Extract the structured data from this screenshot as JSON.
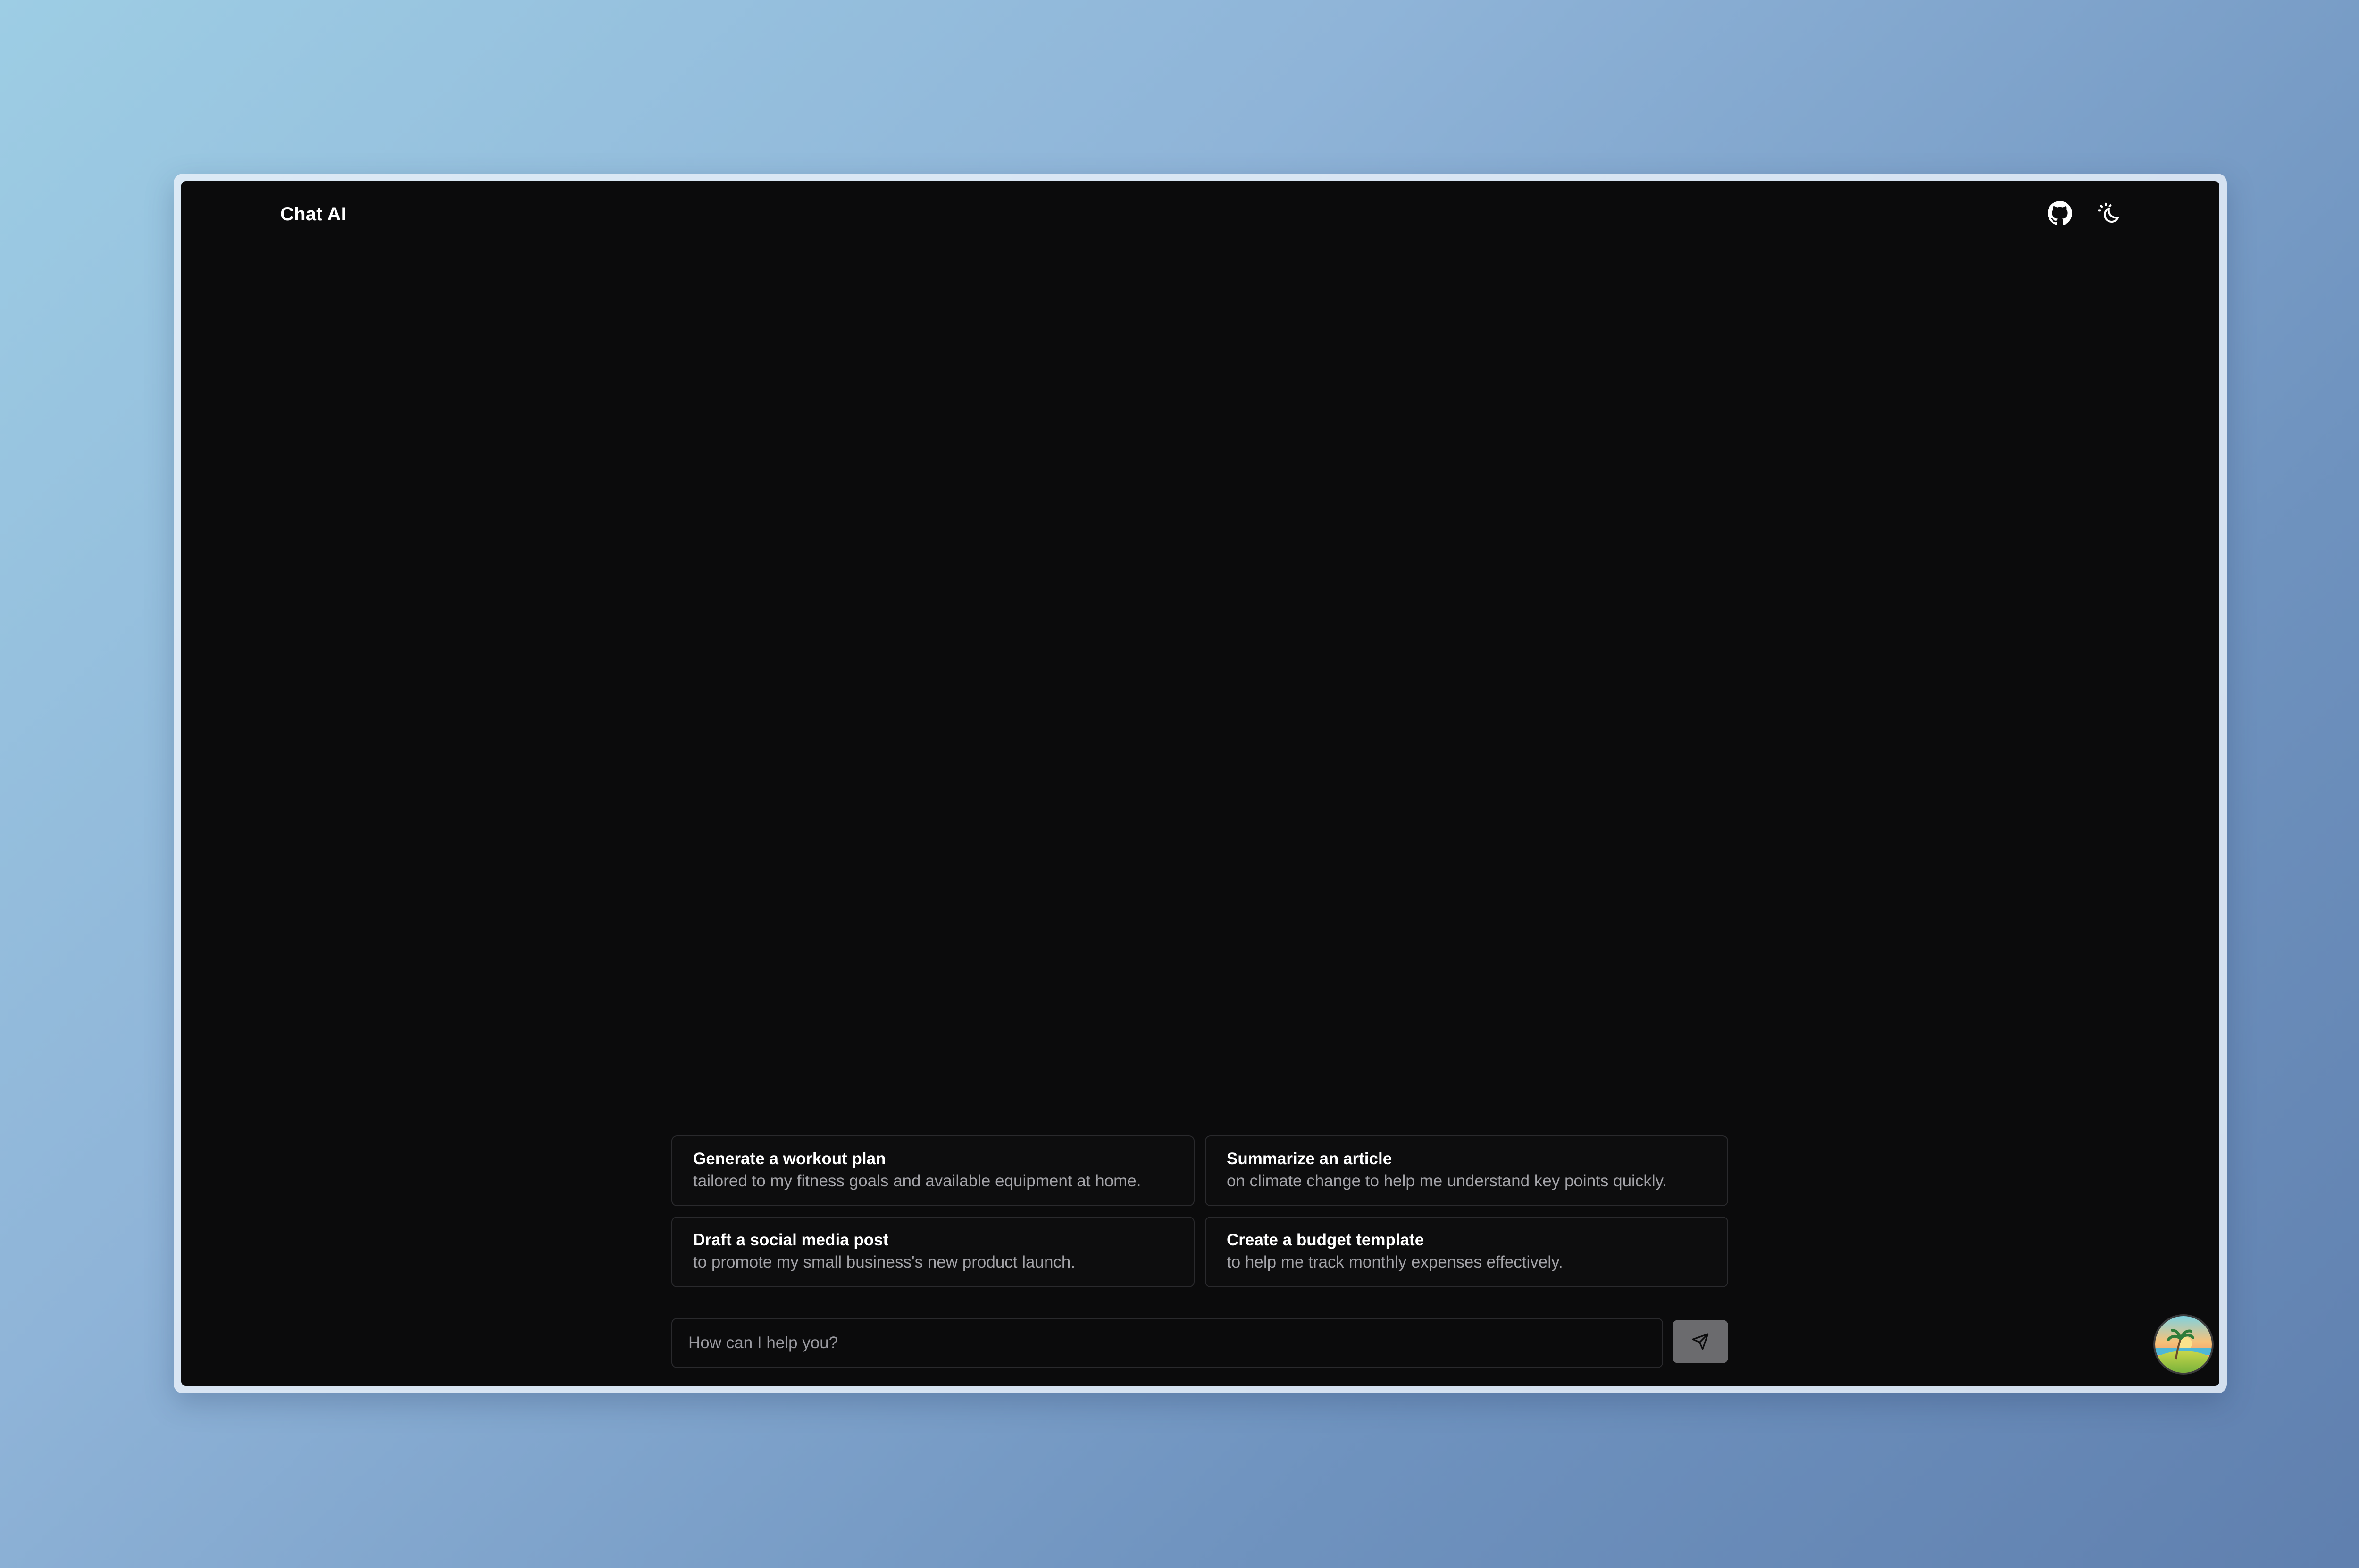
{
  "app": {
    "title": "Chat AI"
  },
  "header": {
    "icons": [
      "github-icon",
      "theme-toggle-icon"
    ]
  },
  "suggestions": [
    {
      "title": "Generate a workout plan",
      "subtitle": "tailored to my fitness goals and available equipment at home."
    },
    {
      "title": "Summarize an article",
      "subtitle": "on climate change to help me understand key points quickly."
    },
    {
      "title": "Draft a social media post",
      "subtitle": "to promote my small business's new product launch."
    },
    {
      "title": "Create a budget template",
      "subtitle": "to help me track monthly expenses effectively."
    }
  ],
  "composer": {
    "placeholder": "How can I help you?",
    "value": "",
    "send_icon": "send-icon"
  },
  "colors": {
    "app_background": "#0b0b0c",
    "card_border": "#2a2a2d",
    "muted_text": "#a3a3a8",
    "send_button": "#6b6b6e"
  }
}
